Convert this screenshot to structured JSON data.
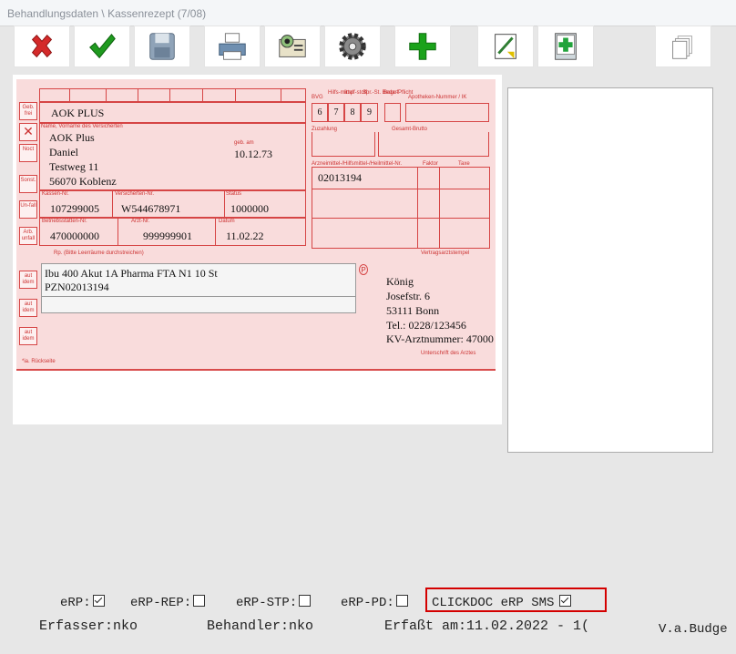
{
  "window": {
    "title": "Behandlungsdaten \\ Kassenrezept (7/08)"
  },
  "toolbar": {
    "buttons": [
      "delete-icon",
      "confirm-icon",
      "save-icon",
      "print-icon",
      "view-card-icon",
      "settings-icon",
      "add-icon",
      "edit-document-icon",
      "add-medicine-book-icon",
      "copy-pages-icon"
    ],
    "colors": {
      "delete": "#d42a2a",
      "confirm": "#1f9a1f",
      "add": "#1aa21a"
    }
  },
  "prescription": {
    "side_labels": [
      "Geb. frei",
      "Noct",
      "Sonst.",
      "Un-fall",
      "Arb. unfall"
    ],
    "cost_bearer": "AOK PLUS",
    "patient_label": "Name, Vorname des Versicherten",
    "insurance_line": "AOK Plus",
    "first_name": "Daniel",
    "street": "Testweg 11",
    "city": "56070 Koblenz",
    "birth_label": "geb. am",
    "birth_date": "10.12.73",
    "kassen_nr_label": "Kassen-Nr.",
    "kassen_nr": "107299005",
    "versicherten_nr_label": "Versicherten-Nr.",
    "versicherten_nr": "W544678971",
    "status_label": "Status",
    "status": "1000000",
    "bsnr_label": "Betriebsstätten-Nr.",
    "bsnr": "470000000",
    "arzt_nr_label": "Arzt-Nr.",
    "arzt_nr": "999999901",
    "datum_label": "Datum",
    "datum": "11.02.22",
    "bvg_label": "BVG",
    "hilfsmittel_label": "Hilfs-mittel",
    "impfstoff_label": "Impf-stoff",
    "spr_label": "Spr.-St. Bedarf",
    "begr_label": "Begr.-Pflicht",
    "apotheken_label": "Apotheken-Nummer / IK",
    "codes": [
      "6",
      "7",
      "8",
      "9"
    ],
    "zuzahlung_label": "Zuzahlung",
    "gesamt_label": "Gesamt-Brutto",
    "arznei_label": "Arzneimittel-/Hilfsmittel-/Heilmittel-Nr.",
    "faktor_label": "Faktor",
    "taxe_label": "Taxe",
    "pzn_code": "02013194",
    "vertragsarzt_label": "Vertragsarztstempel",
    "rp_label": "Rp. (Bitte Leerräume durchstreichen)",
    "aut_idem": "aut idem",
    "med_line1": "Ibu 400 Akut 1A Pharma FTA N1 10 St",
    "med_line2": "PZN02013194",
    "p_badge": "P",
    "doctor_name": "König",
    "doctor_street": "Josefstr. 6",
    "doctor_city": "53111 Bonn",
    "doctor_phone": "Tel.: 0228/123456",
    "doctor_kv": "KV-Arztnummer: 47000",
    "signature_label": "Unterschrift des Arztes",
    "footnote": "*ia. Rückseite"
  },
  "footer": {
    "erp_label": "eRP:",
    "erp_checked": true,
    "erp_rep_label": "eRP-REP:",
    "erp_rep_checked": false,
    "erp_stp_label": "eRP-STP:",
    "erp_stp_checked": false,
    "erp_pd_label": "eRP-PD:",
    "erp_pd_checked": false,
    "clickdoc_label": "CLICKDOC eRP SMS",
    "clickdoc_checked": true,
    "erfasser_label": "Erfasser:",
    "erfasser_value": "nko",
    "behandler_label": "Behandler:",
    "behandler_value": "nko",
    "erfasst_label": "Erfaßt am:",
    "erfasst_value": "11.02.2022 - 1(",
    "budget_label": "V.a.Budge"
  }
}
